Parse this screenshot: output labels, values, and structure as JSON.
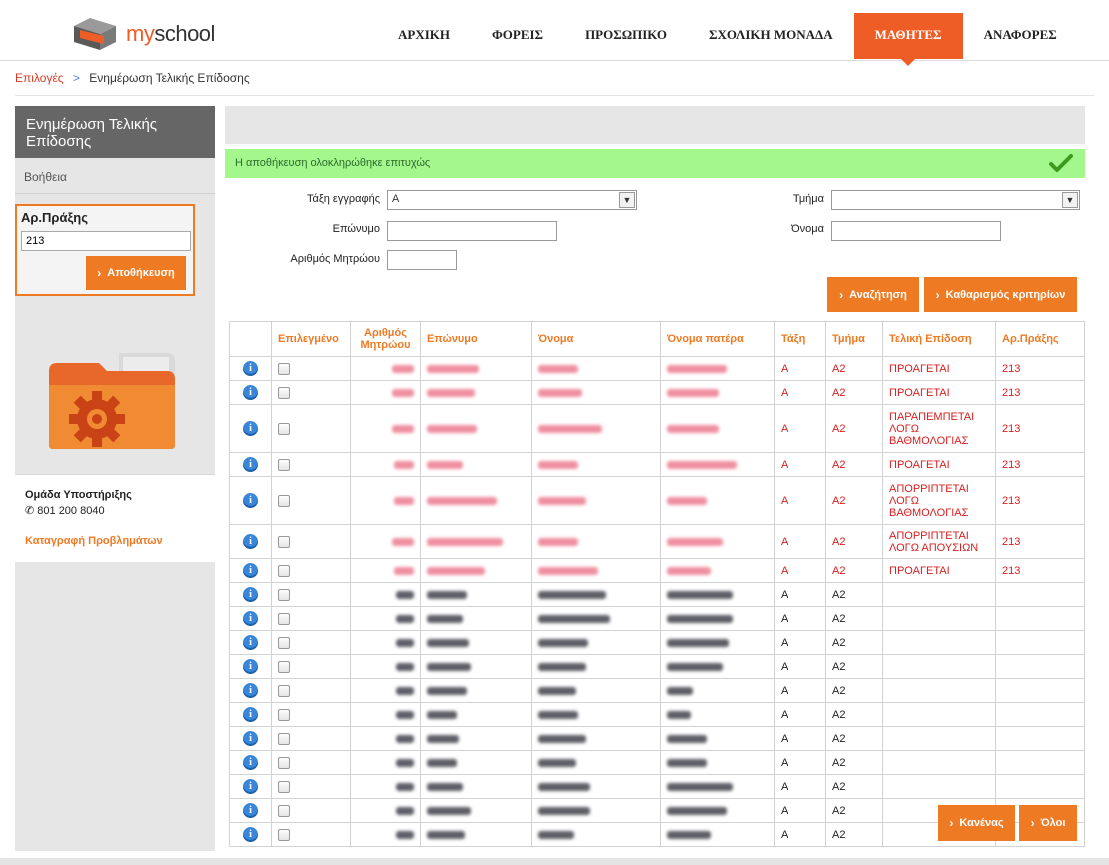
{
  "header": {
    "logo_text": "myschool",
    "nav": [
      "ΑΡΧΙΚΗ",
      "ΦΟΡΕΙΣ",
      "ΠΡΟΣΩΠΙΚΟ",
      "ΣΧΟΛΙΚΗ ΜΟΝΑΔΑ",
      "ΜΑΘΗΤΕΣ",
      "ΑΝΑΦΟΡΕΣ"
    ],
    "active_nav": "ΜΑΘΗΤΕΣ",
    "accent_color": "#ef5d27"
  },
  "breadcrumb": {
    "root": "Επιλογές",
    "separator": ">",
    "current": "Ενημέρωση Τελικής Επίδοσης"
  },
  "sidebar": {
    "title": "Ενημέρωση Τελικής Επίδοσης",
    "help": "Βοήθεια",
    "act_label": "Αρ.Πράξης",
    "act_value": "213",
    "save_label": "Αποθήκευση",
    "support_title": "Ομάδα Υποστήριξης",
    "support_phone": "801 200 8040",
    "report_link": "Καταγραφή Προβλημάτων",
    "folder_icon": "settings-folder-icon"
  },
  "main": {
    "success_message": "Η αποθήκευση ολοκληρώθηκε επιτυχώς",
    "filters": {
      "class_label": "Τάξη εγγραφής",
      "class_value": "Α",
      "section_label": "Τμήμα",
      "section_value": "",
      "surname_label": "Επώνυμο",
      "name_label": "Όνομα",
      "reg_label": "Αριθμός Μητρώου"
    },
    "search_label": "Αναζήτηση",
    "clear_label": "Καθαρισμός κριτηρίων",
    "none_label": "Κανένας",
    "all_label": "Όλοι"
  },
  "table": {
    "columns": [
      "",
      "Επιλεγμένο",
      "Αριθμός Μητρώου",
      "Επώνυμο",
      "Όνομα",
      "Όνομα πατέρα",
      "Τάξη",
      "Τμήμα",
      "Τελική Επίδοση",
      "Αρ.Πράξης"
    ],
    "rows": [
      {
        "class": "Α",
        "section": "Α2",
        "result": "ΠΡΟΑΓΕΤΑΙ",
        "act": "213",
        "highlight": true,
        "size": "normal"
      },
      {
        "class": "Α",
        "section": "Α2",
        "result": "ΠΡΟΑΓΕΤΑΙ",
        "act": "213",
        "highlight": true,
        "size": "normal"
      },
      {
        "class": "Α",
        "section": "Α2",
        "result": "ΠΑΡΑΠΕΜΠΕΤΑΙ ΛΟΓΩ ΒΑΘΜΟΛΟΓΙΑΣ",
        "act": "213",
        "highlight": true,
        "size": "tall"
      },
      {
        "class": "Α",
        "section": "Α2",
        "result": "ΠΡΟΑΓΕΤΑΙ",
        "act": "213",
        "highlight": true,
        "size": "normal"
      },
      {
        "class": "Α",
        "section": "Α2",
        "result": "ΑΠΟΡΡΙΠΤΕΤΑΙ ΛΟΓΩ ΒΑΘΜΟΛΟΓΙΑΣ",
        "act": "213",
        "highlight": true,
        "size": "tall"
      },
      {
        "class": "Α",
        "section": "Α2",
        "result": "ΑΠΟΡΡΙΠΤΕΤΑΙ ΛΟΓΩ ΑΠΟΥΣΙΩΝ",
        "act": "213",
        "highlight": true,
        "size": "mid"
      },
      {
        "class": "Α",
        "section": "Α2",
        "result": "ΠΡΟΑΓΕΤΑΙ",
        "act": "213",
        "highlight": true,
        "size": "normal"
      },
      {
        "class": "Α",
        "section": "Α2",
        "result": "",
        "act": "",
        "highlight": false,
        "size": "normal"
      },
      {
        "class": "Α",
        "section": "Α2",
        "result": "",
        "act": "",
        "highlight": false,
        "size": "normal"
      },
      {
        "class": "Α",
        "section": "Α2",
        "result": "",
        "act": "",
        "highlight": false,
        "size": "normal"
      },
      {
        "class": "Α",
        "section": "Α2",
        "result": "",
        "act": "",
        "highlight": false,
        "size": "normal"
      },
      {
        "class": "Α",
        "section": "Α2",
        "result": "",
        "act": "",
        "highlight": false,
        "size": "normal"
      },
      {
        "class": "Α",
        "section": "Α2",
        "result": "",
        "act": "",
        "highlight": false,
        "size": "normal"
      },
      {
        "class": "Α",
        "section": "Α2",
        "result": "",
        "act": "",
        "highlight": false,
        "size": "normal"
      },
      {
        "class": "Α",
        "section": "Α2",
        "result": "",
        "act": "",
        "highlight": false,
        "size": "normal"
      },
      {
        "class": "Α",
        "section": "Α2",
        "result": "",
        "act": "",
        "highlight": false,
        "size": "normal"
      },
      {
        "class": "Α",
        "section": "Α2",
        "result": "",
        "act": "",
        "highlight": false,
        "size": "normal"
      },
      {
        "class": "Α",
        "section": "Α2",
        "result": "",
        "act": "",
        "highlight": false,
        "size": "normal"
      }
    ]
  }
}
